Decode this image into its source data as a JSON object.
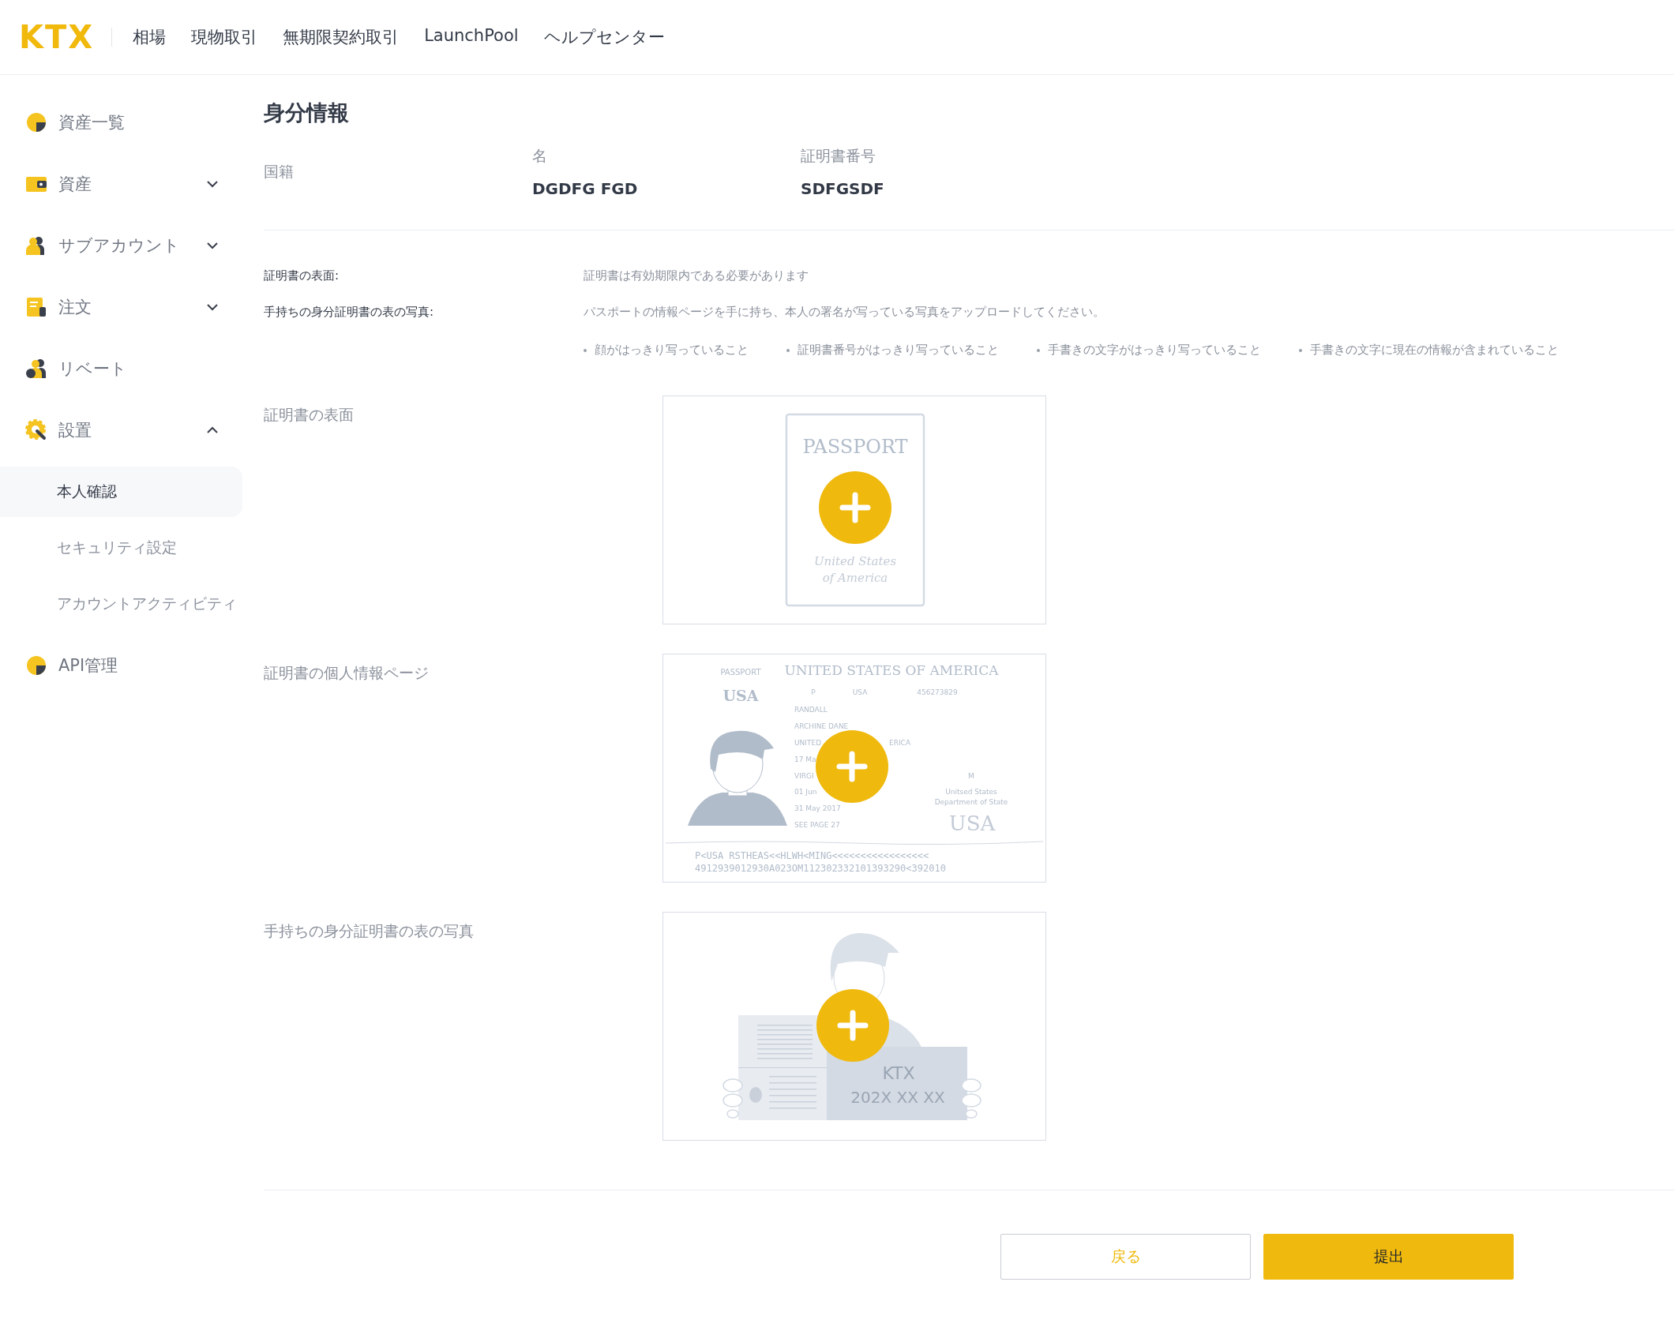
{
  "header": {
    "logo": "KTX",
    "nav": [
      "相場",
      "現物取引",
      "無期限契約取引",
      "LaunchPool",
      "ヘルプセンター"
    ]
  },
  "sidebar": {
    "items": [
      {
        "label": "資産一覧"
      },
      {
        "label": "資産",
        "expanded": false
      },
      {
        "label": "サブアカウント",
        "expanded": false
      },
      {
        "label": "注文",
        "expanded": false
      },
      {
        "label": "リベート"
      },
      {
        "label": "設置",
        "expanded": true,
        "children": [
          {
            "label": "本人確認",
            "selected": true
          },
          {
            "label": "セキュリティ設定",
            "selected": false
          },
          {
            "label": "アカウントアクティビティ",
            "selected": false
          }
        ]
      },
      {
        "label": "API管理"
      }
    ]
  },
  "title": "身分情報",
  "info": {
    "nationality_label": "国籍",
    "fields": [
      {
        "label": "名",
        "value": "DGDFG FGD"
      },
      {
        "label": "証明書番号",
        "value": "SDFGSDF"
      }
    ]
  },
  "requirements": [
    {
      "label": "証明書の表面:",
      "text": "証明書は有効期限内である必要があります"
    },
    {
      "label": "手持ちの身分証明書の表の写真:",
      "text": "パスポートの情報ページを手に持ち、本人の署名が写っている写真をアップロードしてください。"
    }
  ],
  "bullets": [
    "顔がはっきり写っていること",
    "証明書番号がはっきり写っていること",
    "手書きの文字がはっきり写っていること",
    "手書きの文字に現在の情報が含まれていること"
  ],
  "uploads": [
    {
      "label": "証明書の表面",
      "kind": "cover",
      "texts": [
        "PASSPORT",
        "United States",
        "of America"
      ]
    },
    {
      "label": "証明書の個人情報ページ",
      "kind": "info_page",
      "texts": [
        "PASSPORT",
        "USA",
        "UNITED STATES OF AMERICA",
        "P",
        "USA",
        "456273829",
        "RANDALL",
        "ARCHINE DANE",
        "UNITED",
        "ERICA",
        "17 Ma",
        "VIRGI",
        "01 Jun",
        "31 May 2017",
        "SEE PAGE 27",
        "M",
        "Unitsed States",
        "Department of State",
        "USA",
        "P<USA RSTHEAS<<HLWH<MING<<<<<<<<<<<<<<<<<",
        "4912939012930A023OM112302332101393290<392010"
      ]
    },
    {
      "label": "手持ちの身分証明書の表の写真",
      "kind": "selfie",
      "texts": [
        "KTX",
        "202X XX XX"
      ]
    }
  ],
  "buttons": {
    "back": "戻る",
    "submit": "提出"
  }
}
